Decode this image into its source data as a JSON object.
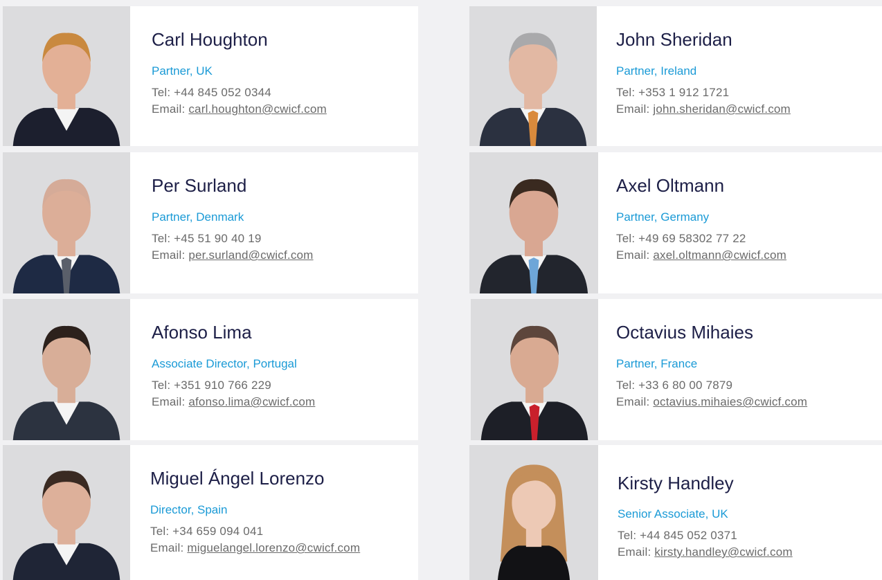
{
  "email_prefix": "Email: ",
  "people": [
    {
      "name": "Carl Houghton",
      "role": "Partner, UK",
      "tel": "Tel: +44 845 052 0344",
      "email": "carl.houghton@cwicf.com",
      "hair": "#c9893f",
      "skin": "#e3b096",
      "tie": ""
    },
    {
      "name": "John Sheridan",
      "role": "Partner, Ireland",
      "tel": "Tel: +353 1 912 1721",
      "email": "john.sheridan@cwicf.com",
      "hair": "#a9a9ab",
      "skin": "#e2b8a3",
      "tie": "#d98a3c"
    },
    {
      "name": "Per Surland",
      "role": "Partner, Denmark",
      "tel": "Tel: +45 51 90 40 19",
      "email": "per.surland@cwicf.com",
      "hair": "#d5ab98",
      "skin": "#dcae98",
      "tie": "#5a5f6a"
    },
    {
      "name": "Axel Oltmann",
      "role": "Partner, Germany",
      "tel": "Tel: +49 69 58302 77 22",
      "email": "axel.oltmann@cwicf.com",
      "hair": "#3a2a20",
      "skin": "#d9a792",
      "tie": "#6ea6d8"
    },
    {
      "name": "Afonso Lima",
      "role": "Associate Director, Portugal",
      "tel": "Tel: +351 910 766 229",
      "email": "afonso.lima@cwicf.com",
      "hair": "#2c211c",
      "skin": "#d8ae98",
      "tie": ""
    },
    {
      "name": "Octavius Mihaies",
      "role": "Partner, France",
      "tel": "Tel: +33 6 80 00 7879",
      "email": "octavius.mihaies@cwicf.com",
      "hair": "#5d463c",
      "skin": "#d9aa92",
      "tie": "#c9202c"
    },
    {
      "name": "Miguel Ángel Lorenzo",
      "role": "Director, Spain",
      "tel": "Tel: +34 659 094 041",
      "email": "miguelangel.lorenzo@cwicf.com",
      "hair": "#3a2a22",
      "skin": "#ddb09a",
      "tie": ""
    },
    {
      "name": "Kirsty Handley",
      "role": "Senior Associate, UK",
      "tel": "Tel: +44 845 052 0371",
      "email": "kirsty.handley@cwicf.com",
      "hair": "#c48f5b",
      "skin": "#edc9b5",
      "tie": ""
    }
  ]
}
